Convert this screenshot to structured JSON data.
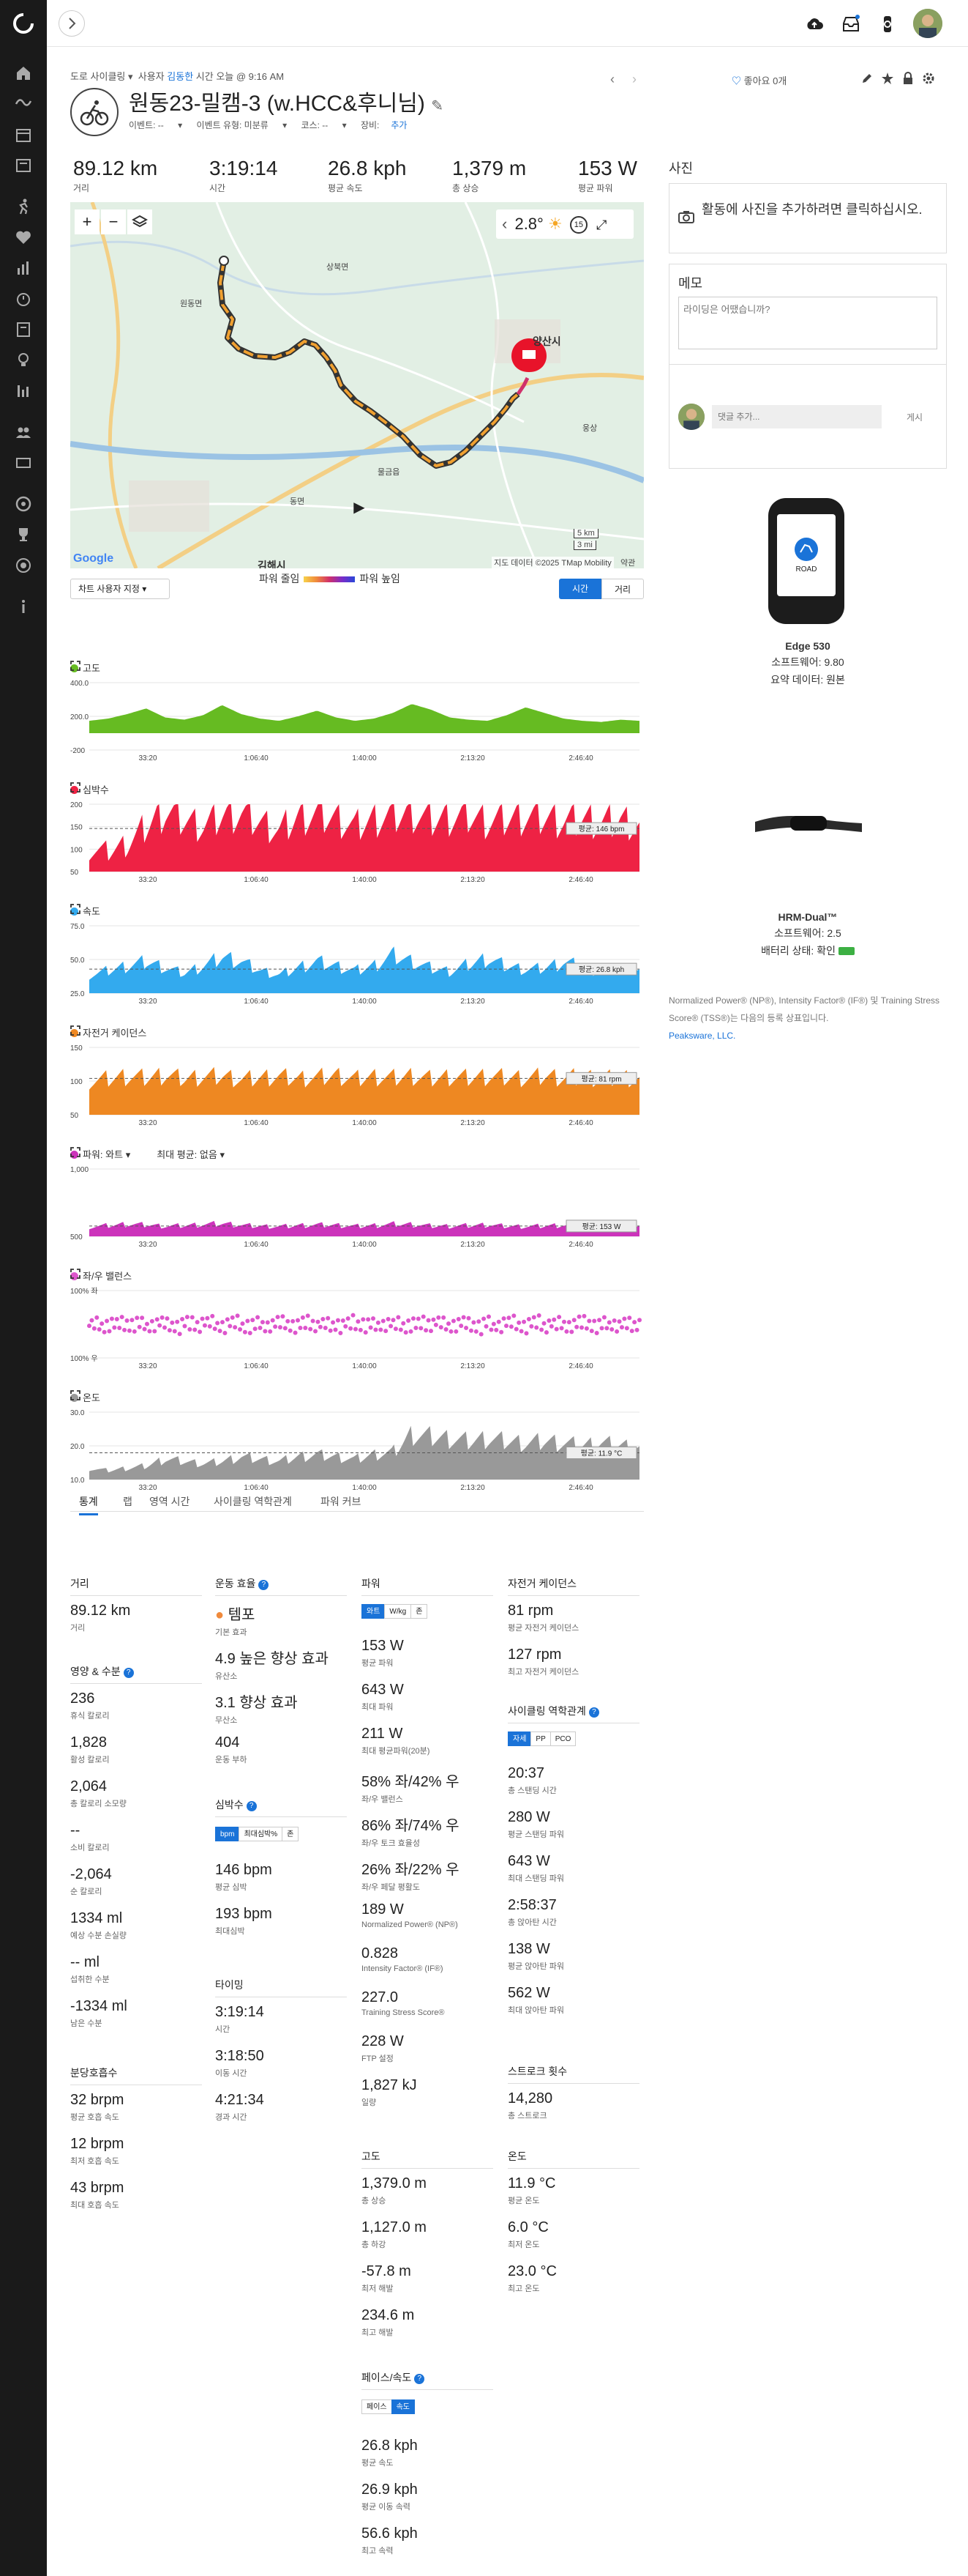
{
  "header": {
    "breadcrumb_type": "도로 사이클링",
    "breadcrumb_user_prefix": "사용자",
    "breadcrumb_user": "김동한",
    "breadcrumb_time": "시간 오늘 @ 9:16 AM",
    "like_label": "좋아요 0개",
    "title": "원동23-밀캠-3 (w.HCC&후니님)",
    "event_label": "이벤트: --",
    "event_type_label": "이벤트 유형: 미분류",
    "course_label": "코스: --",
    "gear_label": "장비:",
    "gear_add": "추가"
  },
  "summary": [
    {
      "value": "89.12 km",
      "label": "거리"
    },
    {
      "value": "3:19:14",
      "label": "시간"
    },
    {
      "value": "26.8 kph",
      "label": "평균 속도"
    },
    {
      "value": "1,379 m",
      "label": "총 상승"
    },
    {
      "value": "153 W",
      "label": "평균 파워"
    }
  ],
  "map": {
    "temperature": "2.8°",
    "timer_badge": "15",
    "city_yangsan": "양산시",
    "city_gimhae": "김해시",
    "towns": [
      "원동면",
      "상북면",
      "물금읍",
      "동면",
      "웅상"
    ],
    "scale_km": "5 km",
    "scale_mi": "3 mi",
    "attribution": "지도 데이터 ©2025 TMap Mobility",
    "terms": "약관",
    "google": "Google"
  },
  "power_legend": {
    "low": "파워 줄임",
    "high": "파워 높임"
  },
  "chart_controls": {
    "select": "차트 사용자 지정",
    "time": "시간",
    "distance": "거리"
  },
  "chart_data": [
    {
      "type": "area",
      "title": "고도",
      "color": "#66bb22",
      "ylim": [
        -200,
        400
      ],
      "y_ticks": [
        "400.0",
        "200.0",
        "-200"
      ],
      "x_ticks": [
        "33:20",
        "1:06:40",
        "1:40:00",
        "2:13:20",
        "2:46:40"
      ],
      "values": [
        60,
        80,
        120,
        170,
        90,
        70,
        110,
        200,
        120,
        80,
        60,
        100,
        150,
        90,
        60,
        80,
        130,
        210,
        160,
        90,
        70,
        60,
        110,
        180,
        130,
        80,
        60,
        50,
        70,
        60
      ],
      "avg": null
    },
    {
      "type": "area",
      "title": "심박수",
      "color": "#ee2244",
      "ylim": [
        50,
        200
      ],
      "y_ticks": [
        "200",
        "150",
        "100",
        "50"
      ],
      "x_ticks": [
        "33:20",
        "1:06:40",
        "1:40:00",
        "2:13:20",
        "2:46:40"
      ],
      "values": [
        100,
        95,
        110,
        150,
        185,
        165,
        150,
        175,
        180,
        160,
        140,
        170,
        178,
        168,
        150,
        165,
        175,
        180,
        165,
        170,
        175,
        160,
        168,
        172,
        170,
        162,
        168,
        158,
        165,
        150
      ],
      "avg": 146,
      "avg_label": "평균: 146 bpm"
    },
    {
      "type": "area",
      "title": "속도",
      "color": "#33aaee",
      "ylim": [
        0,
        75
      ],
      "y_ticks": [
        "75.0",
        "50.0",
        "25.0"
      ],
      "x_ticks": [
        "33:20",
        "1:06:40",
        "1:40:00",
        "2:13:20",
        "2:46:40"
      ],
      "values": [
        20,
        25,
        30,
        35,
        28,
        22,
        30,
        40,
        35,
        25,
        20,
        28,
        35,
        30,
        25,
        30,
        42,
        35,
        28,
        24,
        32,
        38,
        30,
        26,
        28,
        34,
        30,
        22,
        28,
        25
      ],
      "avg": 26.8,
      "avg_label": "평균: 26.8 kph"
    },
    {
      "type": "area",
      "title": "자전거 케이던스",
      "color": "#ee8822",
      "ylim": [
        0,
        150
      ],
      "y_ticks": [
        "150",
        "100",
        "50"
      ],
      "x_ticks": [
        "33:20",
        "1:06:40",
        "1:40:00",
        "2:13:20",
        "2:46:40"
      ],
      "values": [
        75,
        80,
        85,
        82,
        88,
        80,
        84,
        86,
        78,
        82,
        85,
        80,
        83,
        87,
        80,
        84,
        82,
        86,
        80,
        84,
        82,
        85,
        83,
        81,
        86,
        82,
        84,
        80,
        83,
        79
      ],
      "avg": 81,
      "avg_label": "평균: 81 rpm"
    },
    {
      "type": "area",
      "title": "파워: 와트",
      "title_extra": "최대 평균: 없음",
      "color": "#cc33bb",
      "ylim": [
        0,
        1000
      ],
      "y_ticks": [
        "1,000",
        "500"
      ],
      "x_ticks": [
        "33:20",
        "1:06:40",
        "1:40:00",
        "2:13:20",
        "2:46:40"
      ],
      "values": [
        140,
        160,
        180,
        170,
        150,
        160,
        175,
        190,
        165,
        150,
        145,
        160,
        170,
        165,
        150,
        160,
        180,
        175,
        155,
        150,
        160,
        170,
        150,
        145,
        155,
        165,
        150,
        140,
        150,
        145
      ],
      "avg": 153,
      "avg_label": "평균: 153 W"
    },
    {
      "type": "scatter",
      "title": "좌/우 밸런스",
      "color": "#dd55cc",
      "ylim": [
        -100,
        100
      ],
      "y_ticks": [
        "100% 좌",
        "100% 우"
      ],
      "x_ticks": [
        "33:20",
        "1:06:40",
        "1:40:00",
        "2:13:20",
        "2:46:40"
      ],
      "values": [
        16,
        10,
        20,
        14,
        18,
        12,
        22,
        16,
        14,
        18,
        20,
        12,
        16,
        14,
        18,
        20,
        15,
        17,
        13,
        19,
        16,
        14,
        18,
        12,
        20,
        16,
        15,
        17,
        14,
        18
      ],
      "avg": null
    },
    {
      "type": "area",
      "title": "온도",
      "color": "#999999",
      "ylim": [
        0,
        30
      ],
      "y_ticks": [
        "30.0",
        "20.0",
        "10.0"
      ],
      "x_ticks": [
        "33:20",
        "1:06:40",
        "1:40:00",
        "2:13:20",
        "2:46:40"
      ],
      "values": [
        5,
        4,
        5,
        6,
        9,
        8,
        7,
        8,
        10,
        9,
        8,
        10,
        11,
        10,
        9,
        11,
        12,
        20,
        19,
        18,
        17,
        18,
        17,
        16,
        17,
        16,
        15,
        16,
        15,
        14
      ],
      "avg": 11.9,
      "avg_label": "평균: 11.9 °C"
    }
  ],
  "tabs": [
    "통계",
    "랩",
    "영역 시간",
    "사이클링 역학관계",
    "파워 커브"
  ],
  "stats": {
    "distance_title": "거리",
    "distance": {
      "value": "89.12 km",
      "label": "거리"
    },
    "nutrition_title": "영양 & 수분",
    "nutrition": [
      {
        "value": "236",
        "label": "휴식 칼로리"
      },
      {
        "value": "1,828",
        "label": "활성 칼로리"
      },
      {
        "value": "2,064",
        "label": "총 칼로리 소모량"
      },
      {
        "value": "--",
        "label": "소비 칼로리"
      },
      {
        "value": "-2,064",
        "label": "순 칼로리"
      },
      {
        "value": "1334 ml",
        "label": "예상 수분 손실량"
      },
      {
        "value": "-- ml",
        "label": "섭취한 수분"
      },
      {
        "value": "-1334 ml",
        "label": "남은 수분"
      }
    ],
    "breath_title": "분당호흡수",
    "breath": [
      {
        "value": "32 brpm",
        "label": "평균 호흡 속도"
      },
      {
        "value": "12 brpm",
        "label": "최저 호흡 속도"
      },
      {
        "value": "43 brpm",
        "label": "최대 호흡 속도"
      }
    ],
    "effect_title": "운동 효율",
    "effect_dot": "템포",
    "effect_dot_label": "기본 효과",
    "effect": [
      {
        "value": "4.9 높은 향상 효과",
        "label": "유산소"
      },
      {
        "value": "3.1 향상 효과",
        "label": "무산소"
      },
      {
        "value": "404",
        "label": "운동 부하"
      }
    ],
    "hr_title": "심박수",
    "hr_seg": [
      "bpm",
      "최대심박%",
      "존"
    ],
    "hr": [
      {
        "value": "146 bpm",
        "label": "평균 심박"
      },
      {
        "value": "193 bpm",
        "label": "최대심박"
      }
    ],
    "timing_title": "타이밍",
    "timing": [
      {
        "value": "3:19:14",
        "label": "시간"
      },
      {
        "value": "3:18:50",
        "label": "이동 시간"
      },
      {
        "value": "4:21:34",
        "label": "경과 시간"
      }
    ],
    "power_title": "파워",
    "power_seg": [
      "와트",
      "W/kg",
      "존"
    ],
    "power": [
      {
        "value": "153 W",
        "label": "평균 파워"
      },
      {
        "value": "643 W",
        "label": "최대 파워"
      },
      {
        "value": "211 W",
        "label": "최대 평균파워(20분)"
      },
      {
        "value": "58% 좌/42% 우",
        "label": "좌/우 밸런스"
      },
      {
        "value": "86% 좌/74% 우",
        "label": "좌/우 토크 효율성"
      },
      {
        "value": "26% 좌/22% 우",
        "label": "좌/우 페달 평활도"
      },
      {
        "value": "189 W",
        "label": "Normalized Power® (NP®)"
      },
      {
        "value": "0.828",
        "label": "Intensity Factor® (IF®)"
      },
      {
        "value": "227.0",
        "label": "Training Stress Score®"
      },
      {
        "value": "228 W",
        "label": "FTP 설정"
      },
      {
        "value": "1,827 kJ",
        "label": "일량"
      }
    ],
    "elev_title": "고도",
    "elev": [
      {
        "value": "1,379.0 m",
        "label": "총 상승"
      },
      {
        "value": "1,127.0 m",
        "label": "총 하강"
      },
      {
        "value": "-57.8 m",
        "label": "최저 해발"
      },
      {
        "value": "234.6 m",
        "label": "최고 해발"
      }
    ],
    "pace_title": "페이스/속도",
    "pace_seg": [
      "페이스",
      "속도"
    ],
    "pace": [
      {
        "value": "26.8 kph",
        "label": "평균 속도"
      },
      {
        "value": "26.9 kph",
        "label": "평균 이동 속력"
      },
      {
        "value": "56.6 kph",
        "label": "최고 속력"
      }
    ],
    "cad_title": "자전거 케이던스",
    "cad": [
      {
        "value": "81 rpm",
        "label": "평균 자전거 케이던스"
      },
      {
        "value": "127 rpm",
        "label": "최고 자전거 케이던스"
      }
    ],
    "dyn_title": "사이클링 역학관계",
    "dyn_seg": [
      "자세",
      "PP",
      "PCO"
    ],
    "dyn": [
      {
        "value": "20:37",
        "label": "총 스탠딩 시간"
      },
      {
        "value": "280 W",
        "label": "평균 스탠딩 파워"
      },
      {
        "value": "643 W",
        "label": "최대 스탠딩 파워"
      },
      {
        "value": "2:58:37",
        "label": "총 앉아탄 시간"
      },
      {
        "value": "138 W",
        "label": "평균 앉아탄 파워"
      },
      {
        "value": "562 W",
        "label": "최대 앉아탄 파워"
      }
    ],
    "stroke_title": "스트로크 횟수",
    "stroke": {
      "value": "14,280",
      "label": "총 스트로크"
    },
    "temp_title": "온도",
    "temp": [
      {
        "value": "11.9 °C",
        "label": "평균 온도"
      },
      {
        "value": "6.0 °C",
        "label": "최저 온도"
      },
      {
        "value": "23.0 °C",
        "label": "최고 온도"
      }
    ]
  },
  "right": {
    "photos_title": "사진",
    "photos_prompt": "활동에 사진을 추가하려면 클릭하십시오.",
    "memo_title": "메모",
    "memo_placeholder": "라이딩은 어땠습니까?",
    "comment_placeholder": "댓글 추가...",
    "comment_post": "게시",
    "device1_name": "Edge 530",
    "device1_sw": "소프트웨어: 9.80",
    "device1_data": "요약 데이터: 원본",
    "device1_screen": "ROAD",
    "device2_name": "HRM-Dual™",
    "device2_sw": "소프트웨어: 2.5",
    "device2_battery": "배터리 상태: 확인",
    "legal_text": "Normalized Power® (NP®), Intensity Factor® (IF®) 및 Training Stress Score® (TSS®)는 다음의 등록 상표입니다.",
    "legal_link": "Peaksware, LLC."
  }
}
